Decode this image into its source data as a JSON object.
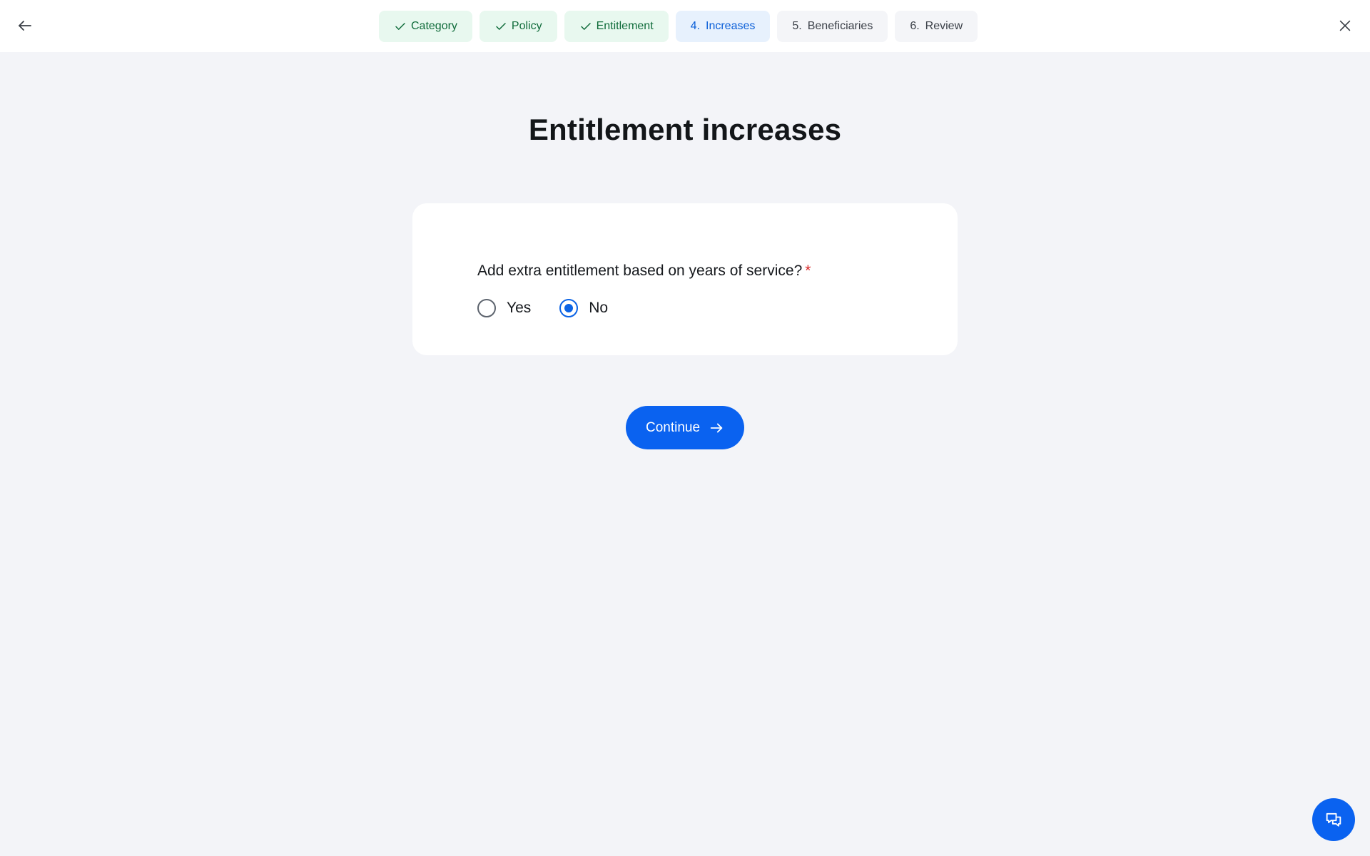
{
  "nav": {
    "back_label": "Back",
    "close_label": "Close"
  },
  "stepper": {
    "steps": [
      {
        "number": "",
        "label": "Category",
        "status": "done"
      },
      {
        "number": "",
        "label": "Policy",
        "status": "done"
      },
      {
        "number": "",
        "label": "Entitlement",
        "status": "done"
      },
      {
        "number": "4.",
        "label": "Increases",
        "status": "current"
      },
      {
        "number": "5.",
        "label": "Beneficiaries",
        "status": "todo"
      },
      {
        "number": "6.",
        "label": "Review",
        "status": "todo"
      }
    ]
  },
  "page": {
    "title": "Entitlement increases"
  },
  "form": {
    "question": "Add extra entitlement based on years of service?",
    "required_marker": "*",
    "options": [
      {
        "label": "Yes",
        "selected": false
      },
      {
        "label": "No",
        "selected": true
      }
    ]
  },
  "actions": {
    "continue_label": "Continue"
  },
  "colors": {
    "primary": "#0a62f0",
    "done_bg": "#e8f8ef",
    "done_text": "#0f6b3a",
    "current_bg": "#e7f1fd",
    "current_text": "#0b5fd8",
    "required": "#d92b2b",
    "page_bg": "#f3f4f8"
  }
}
